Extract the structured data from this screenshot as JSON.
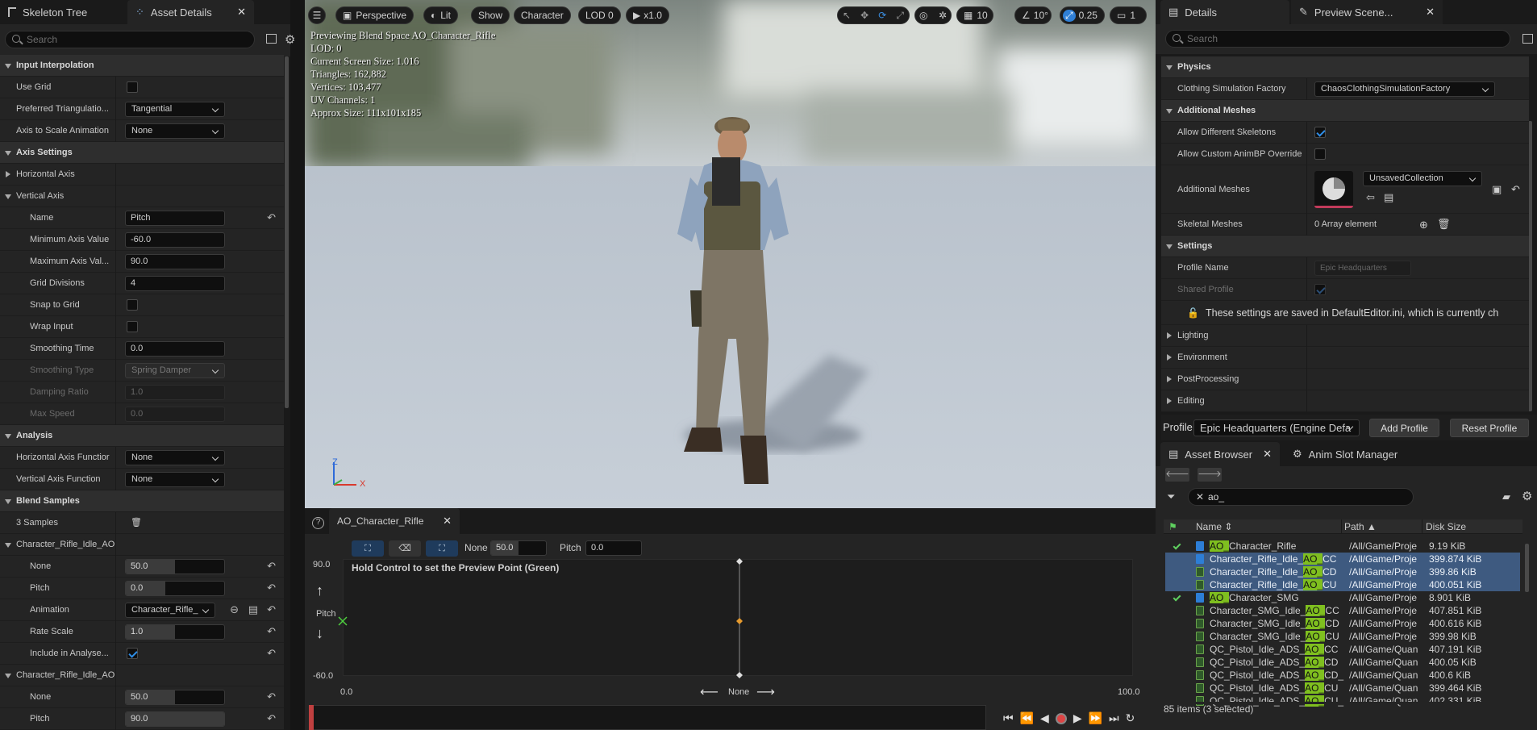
{
  "left_panel": {
    "tabs": [
      {
        "label": "Skeleton Tree"
      },
      {
        "label": "Asset Details"
      }
    ],
    "search_placeholder": "Search",
    "rows": [
      {
        "type": "cat",
        "label": "Input Interpolation",
        "open": true
      },
      {
        "type": "check",
        "label": "Use Grid",
        "checked": false
      },
      {
        "type": "combo",
        "label": "Preferred Triangulatio...",
        "value": "Tangential"
      },
      {
        "type": "combo",
        "label": "Axis to Scale Animation",
        "value": "None"
      },
      {
        "type": "cat",
        "label": "Axis Settings",
        "open": true
      },
      {
        "type": "sub",
        "label": "Horizontal Axis",
        "open": false
      },
      {
        "type": "sub",
        "label": "Vertical Axis",
        "open": true
      },
      {
        "type": "text",
        "label": "Name",
        "value": "Pitch",
        "reset": true
      },
      {
        "type": "text",
        "label": "Minimum Axis Value",
        "value": "-60.0"
      },
      {
        "type": "text",
        "label": "Maximum Axis Val...",
        "value": "90.0"
      },
      {
        "type": "text",
        "label": "Grid Divisions",
        "value": "4"
      },
      {
        "type": "check",
        "label": "Snap to Grid",
        "checked": false
      },
      {
        "type": "check",
        "label": "Wrap Input",
        "checked": false
      },
      {
        "type": "text",
        "label": "Smoothing Time",
        "value": "0.0"
      },
      {
        "type": "combo",
        "label": "Smoothing Type",
        "value": "Spring Damper",
        "dim": true
      },
      {
        "type": "text",
        "label": "Damping Ratio",
        "value": "1.0",
        "dim": true
      },
      {
        "type": "text",
        "label": "Max Speed",
        "value": "0.0",
        "dim": true
      },
      {
        "type": "cat",
        "label": "Analysis",
        "open": true
      },
      {
        "type": "combo",
        "label": "Horizontal Axis Functior",
        "value": "None"
      },
      {
        "type": "combo",
        "label": "Vertical Axis Function",
        "value": "None"
      },
      {
        "type": "cat",
        "label": "Blend Samples",
        "open": true
      },
      {
        "type": "samples",
        "label": "3 Samples"
      },
      {
        "type": "sub",
        "label": "Character_Rifle_Idle_AO",
        "open": true
      },
      {
        "type": "slider",
        "label": "None",
        "value": "50.0",
        "frac": 0.5,
        "reset": true
      },
      {
        "type": "slider",
        "label": "Pitch",
        "value": "0.0",
        "frac": 0.4,
        "reset": true
      },
      {
        "type": "asset",
        "label": "Animation",
        "value": "Character_Rifle_",
        "reset": true
      },
      {
        "type": "slider",
        "label": "Rate Scale",
        "value": "1.0",
        "frac": 0.5,
        "reset": true
      },
      {
        "type": "check",
        "label": "Include in Analyse...",
        "checked": true,
        "reset": true
      },
      {
        "type": "sub",
        "label": "Character_Rifle_Idle_AO",
        "open": true
      },
      {
        "type": "slider",
        "label": "None",
        "value": "50.0",
        "frac": 0.5,
        "reset": true
      },
      {
        "type": "slider",
        "label": "Pitch",
        "value": "90.0",
        "frac": 1.0,
        "reset": true
      }
    ]
  },
  "viewport": {
    "toolbar": {
      "perspective": "Perspective",
      "lit": "Lit",
      "show": "Show",
      "character": "Character",
      "lod": "LOD 0",
      "play": "x1.0",
      "grid": "10",
      "angle": "10°",
      "scale": "0.25",
      "camera": "1"
    },
    "overlay": [
      "Previewing Blend Space AO_Character_Rifle",
      "LOD: 0",
      "Current Screen Size: 1.016",
      "Triangles: 162,882",
      "Vertices: 103,477",
      "UV Channels: 1",
      "Approx Size: 111x101x185"
    ],
    "axes": {
      "z": "Z",
      "x": "X"
    }
  },
  "blend_editor": {
    "tab": "AO_Character_Rifle",
    "none_label": "None",
    "none_value": "50.0",
    "pitch_label": "Pitch",
    "pitch_value": "0.0",
    "hint": "Hold Control to set the Preview Point (Green)",
    "y_max": "90.0",
    "y_min": "-60.0",
    "y_label": "Pitch",
    "x_min": "0.0",
    "x_max": "100.0",
    "x_label": "None"
  },
  "details": {
    "tabs": [
      {
        "label": "Details"
      },
      {
        "label": "Preview Scene..."
      }
    ],
    "search_placeholder": "Search",
    "physics": "Physics",
    "clothing_label": "Clothing Simulation Factory",
    "clothing_value": "ChaosClothingSimulationFactory",
    "additional_meshes_cat": "Additional Meshes",
    "allow_diff_skeletons": "Allow Different Skeletons",
    "allow_custom_animbp": "Allow Custom AnimBP Override",
    "additional_meshes": "Additional Meshes",
    "collection": "UnsavedCollection",
    "skeletal_meshes": "Skeletal Meshes",
    "array_elements": "0 Array element",
    "settings_cat": "Settings",
    "profile_name": "Profile Name",
    "profile_name_value": "Epic Headquarters",
    "shared_profile": "Shared Profile",
    "notice": "These settings are saved in DefaultEditor.ini, which is currently ch",
    "lighting": "Lighting",
    "environment": "Environment",
    "postprocessing": "PostProcessing",
    "editing": "Editing",
    "profile_label": "Profile",
    "profile_value": "Epic Headquarters (Engine Defa",
    "add_profile": "Add Profile",
    "reset_profile": "Reset Profile"
  },
  "asset_browser": {
    "tabs": [
      {
        "label": "Asset Browser"
      },
      {
        "label": "Anim Slot Manager"
      }
    ],
    "filter_value": "ao_",
    "columns": {
      "name": "Name",
      "path": "Path",
      "size": "Disk Size"
    },
    "rows": [
      {
        "pre": "",
        "hl": "AO_",
        "post": "Character_Rifle",
        "path": "/All/Game/Proje",
        "size": "9.19 KiB",
        "kind": "bs",
        "check": true,
        "sel": false
      },
      {
        "pre": "Character_Rifle_Idle_",
        "hl": "AO_",
        "post": "CC",
        "path": "/All/Game/Proje",
        "size": "399.874 KiB",
        "kind": "bs",
        "check": false,
        "sel": true
      },
      {
        "pre": "Character_Rifle_Idle_",
        "hl": "AO_",
        "post": "CD",
        "path": "/All/Game/Proje",
        "size": "399.86 KiB",
        "kind": "an",
        "check": false,
        "sel": true
      },
      {
        "pre": "Character_Rifle_Idle_",
        "hl": "AO_",
        "post": "CU",
        "path": "/All/Game/Proje",
        "size": "400.051 KiB",
        "kind": "an",
        "check": false,
        "sel": true
      },
      {
        "pre": "",
        "hl": "AO_",
        "post": "Character_SMG",
        "path": "/All/Game/Proje",
        "size": "8.901 KiB",
        "kind": "bs",
        "check": true,
        "sel": false
      },
      {
        "pre": "Character_SMG_Idle_",
        "hl": "AO_",
        "post": "CC",
        "path": "/All/Game/Proje",
        "size": "407.851 KiB",
        "kind": "an",
        "check": false,
        "sel": false
      },
      {
        "pre": "Character_SMG_Idle_",
        "hl": "AO_",
        "post": "CD",
        "path": "/All/Game/Proje",
        "size": "400.616 KiB",
        "kind": "an",
        "check": false,
        "sel": false
      },
      {
        "pre": "Character_SMG_Idle_",
        "hl": "AO_",
        "post": "CU",
        "path": "/All/Game/Proje",
        "size": "399.98 KiB",
        "kind": "an",
        "check": false,
        "sel": false
      },
      {
        "pre": "QC_Pistol_Idle_ADS_",
        "hl": "AO_",
        "post": "CC",
        "path": "/All/Game/Quan",
        "size": "407.191 KiB",
        "kind": "an",
        "check": false,
        "sel": false
      },
      {
        "pre": "QC_Pistol_Idle_ADS_",
        "hl": "AO_",
        "post": "CD",
        "path": "/All/Game/Quan",
        "size": "400.05 KiB",
        "kind": "an",
        "check": false,
        "sel": false
      },
      {
        "pre": "QC_Pistol_Idle_ADS_",
        "hl": "AO_",
        "post": "CD_",
        "path": "/All/Game/Quan",
        "size": "400.6 KiB",
        "kind": "an",
        "check": false,
        "sel": false
      },
      {
        "pre": "QC_Pistol_Idle_ADS_",
        "hl": "AO_",
        "post": "CU",
        "path": "/All/Game/Quan",
        "size": "399.464 KiB",
        "kind": "an",
        "check": false,
        "sel": false
      },
      {
        "pre": "QC_Pistol_Idle_ADS_",
        "hl": "AO_",
        "post": "CU_",
        "path": "/All/Game/Quan",
        "size": "402.331 KiB",
        "kind": "an",
        "check": false,
        "sel": false
      }
    ],
    "status": "85 items (3 selected)"
  }
}
